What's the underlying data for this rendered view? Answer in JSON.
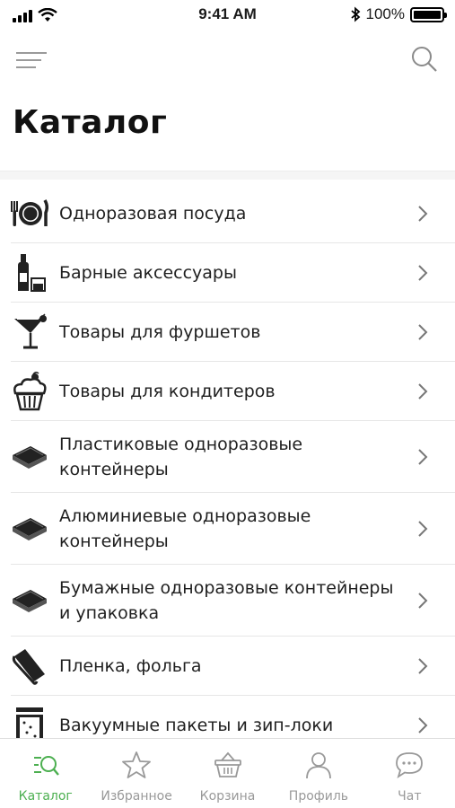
{
  "status_bar": {
    "time": "9:41 AM",
    "battery": "100%"
  },
  "header": {
    "title": "Каталог"
  },
  "catalog": {
    "items": [
      {
        "label": "Одноразовая посуда",
        "icon": "plate-cutlery-icon"
      },
      {
        "label": "Барные аксессуары",
        "icon": "bottle-glass-icon"
      },
      {
        "label": "Товары для фуршетов",
        "icon": "cocktail-icon"
      },
      {
        "label": "Товары для кондитеров",
        "icon": "cupcake-icon"
      },
      {
        "label": "Пластиковые одноразовые контейнеры",
        "icon": "container-icon"
      },
      {
        "label": "Алюминиевые одноразовые контейнеры",
        "icon": "container-icon"
      },
      {
        "label": "Бумажные одноразовые контейнеры и упаковка",
        "icon": "container-icon"
      },
      {
        "label": "Пленка, фольга",
        "icon": "foil-roll-icon"
      },
      {
        "label": "Вакуумные пакеты и зип-локи",
        "icon": "vacuum-bag-icon"
      }
    ]
  },
  "tab_bar": {
    "tabs": [
      {
        "label": "Каталог",
        "icon": "catalog-search-icon",
        "active": true
      },
      {
        "label": "Избранное",
        "icon": "star-icon",
        "active": false
      },
      {
        "label": "Корзина",
        "icon": "basket-icon",
        "active": false
      },
      {
        "label": "Профиль",
        "icon": "person-icon",
        "active": false
      },
      {
        "label": "Чат",
        "icon": "chat-bubble-icon",
        "active": false
      }
    ]
  },
  "colors": {
    "accent": "#4caf50",
    "inactive": "#999999",
    "text": "#1f1f1f"
  }
}
